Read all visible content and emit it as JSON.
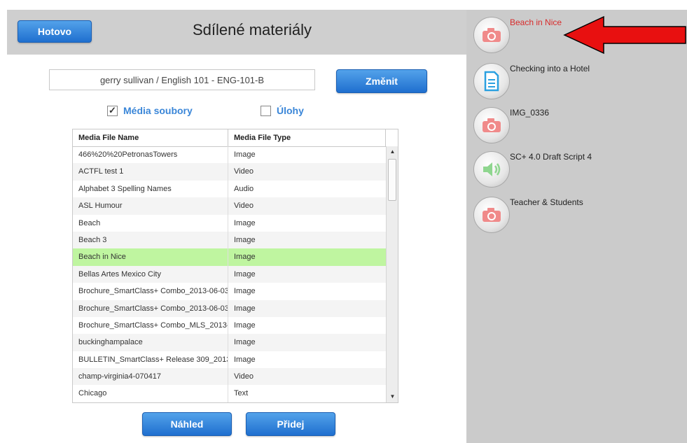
{
  "header": {
    "done_label": "Hotovo",
    "title": "Sdílené materiály"
  },
  "class_selector": {
    "value": "gerry sullivan / English 101 - ENG-101-B",
    "change_label": "Změnit"
  },
  "filters": [
    {
      "label": "Média soubory",
      "checked": true,
      "mark": "✓"
    },
    {
      "label": "Úlohy",
      "checked": false,
      "mark": ""
    }
  ],
  "table": {
    "columns": [
      "Media File Name",
      "Media File Type"
    ],
    "rows": [
      [
        "466%20%20PetronasTowers",
        "Image"
      ],
      [
        "ACTFL test 1",
        "Video"
      ],
      [
        "Alphabet 3 Spelling Names",
        "Audio"
      ],
      [
        "ASL Humour",
        "Video"
      ],
      [
        "Beach",
        "Image"
      ],
      [
        "Beach 3",
        "Image"
      ],
      [
        "Beach in Nice",
        "Image"
      ],
      [
        "Bellas Artes Mexico City",
        "Image"
      ],
      [
        "Brochure_SmartClass+ Combo_2013-06-03",
        "Image"
      ],
      [
        "Brochure_SmartClass+ Combo_2013-06-03",
        "Image"
      ],
      [
        "Brochure_SmartClass+ Combo_MLS_2013-",
        "Image"
      ],
      [
        "buckinghampalace",
        "Image"
      ],
      [
        "BULLETIN_SmartClass+ Release 309_2013",
        "Image"
      ],
      [
        "champ-virginia4-070417",
        "Video"
      ],
      [
        "Chicago",
        "Text"
      ]
    ],
    "selected_row": 6
  },
  "footer": {
    "preview_label": "Náhled",
    "add_label": "Přidej"
  },
  "media_list": [
    {
      "label": "Beach in Nice",
      "icon": "camera-icon",
      "active": true
    },
    {
      "label": "Checking into a Hotel",
      "icon": "document-icon",
      "active": false
    },
    {
      "label": "IMG_0336",
      "icon": "camera-icon",
      "active": false
    },
    {
      "label": "SC+ 4.0 Draft Script 4",
      "icon": "speaker-icon",
      "active": false
    },
    {
      "label": "Teacher & Students",
      "icon": "camera-icon",
      "active": false
    }
  ],
  "colors": {
    "accent": "#2a7fd9",
    "selected_row": "#bff5a0",
    "arrow": "#e81010",
    "active_label": "#d82b2b",
    "camera": "#f08a8a"
  }
}
